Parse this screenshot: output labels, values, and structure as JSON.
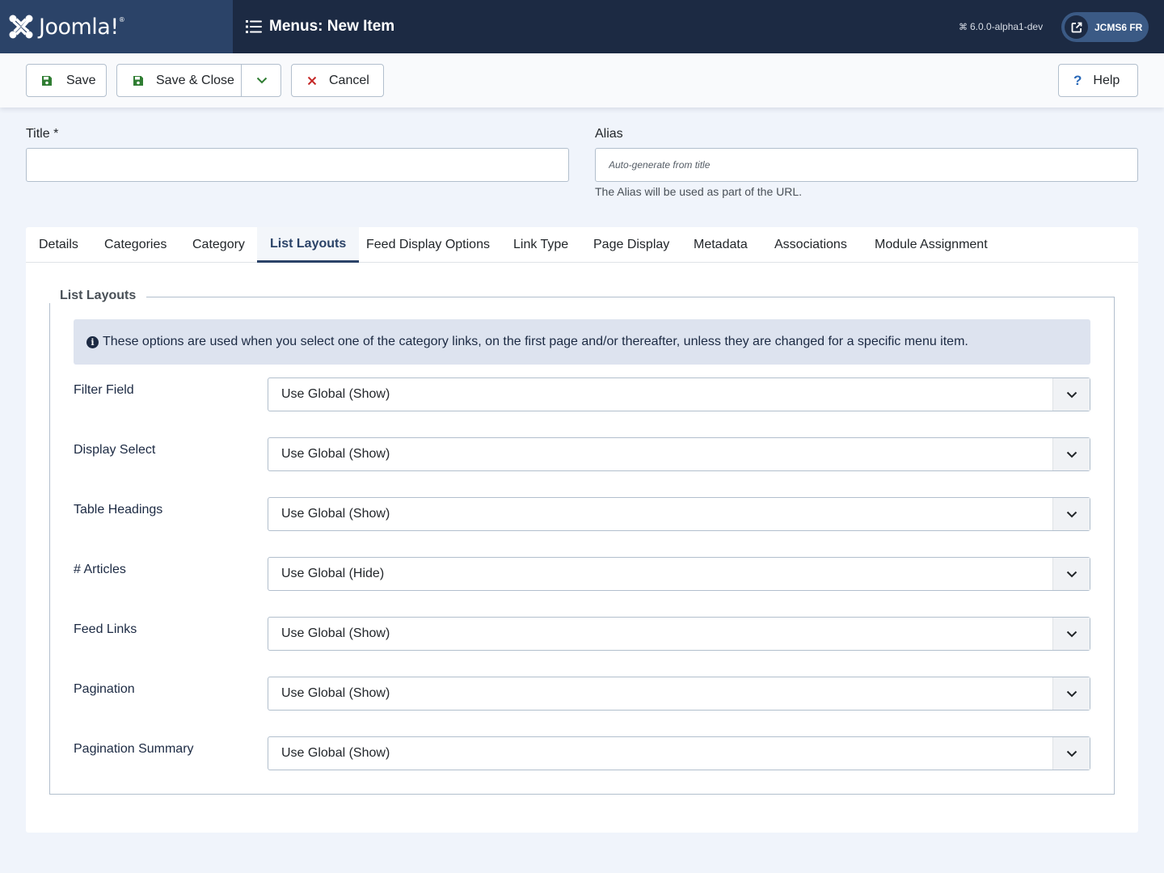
{
  "header": {
    "logo_text": "Joomla!",
    "page_title": "Menus: New Item",
    "version": "6.0.0-alpha1-dev",
    "site_button_label": "JCMS6 FR"
  },
  "toolbar": {
    "save_label": "Save",
    "save_close_label": "Save & Close",
    "cancel_label": "Cancel",
    "help_label": "Help"
  },
  "form": {
    "title_label": "Title *",
    "title_value": "",
    "alias_label": "Alias",
    "alias_placeholder": "Auto-generate from title",
    "alias_hint": "The Alias will be used as part of the URL."
  },
  "tabs": [
    {
      "label": "Details",
      "active": false
    },
    {
      "label": "Categories",
      "active": false
    },
    {
      "label": "Category",
      "active": false
    },
    {
      "label": "List Layouts",
      "active": true
    },
    {
      "label": "Feed Display Options",
      "active": false
    },
    {
      "label": "Link Type",
      "active": false
    },
    {
      "label": "Page Display",
      "active": false
    },
    {
      "label": "Metadata",
      "active": false
    },
    {
      "label": "Associations",
      "active": false
    },
    {
      "label": "Module Assignment",
      "active": false
    }
  ],
  "list_layouts": {
    "legend": "List Layouts",
    "info": "These options are used when you select one of the category links, on the first page and/or thereafter, unless they are changed for a specific menu item.",
    "fields": [
      {
        "label": "Filter Field",
        "value": "Use Global (Show)"
      },
      {
        "label": "Display Select",
        "value": "Use Global (Show)"
      },
      {
        "label": "Table Headings",
        "value": "Use Global (Show)"
      },
      {
        "label": "# Articles",
        "value": "Use Global (Hide)"
      },
      {
        "label": "Feed Links",
        "value": "Use Global (Show)"
      },
      {
        "label": "Pagination",
        "value": "Use Global (Show)"
      },
      {
        "label": "Pagination Summary",
        "value": "Use Global (Show)"
      }
    ]
  },
  "colors": {
    "header_bg": "#1c2a43",
    "logo_bg": "#2b4368",
    "accent": "#2b4368",
    "save_icon": "#2f7d32",
    "cancel_icon": "#c52827",
    "help_icon": "#2a69b8"
  },
  "icons": {
    "logo": "joomla-logo-icon",
    "menu_list": "list-icon",
    "external": "external-link-icon",
    "save": "floppy-disk-icon",
    "dropdown": "chevron-down-icon",
    "cancel": "close-icon",
    "help": "question-icon",
    "info": "info-circle-icon"
  }
}
